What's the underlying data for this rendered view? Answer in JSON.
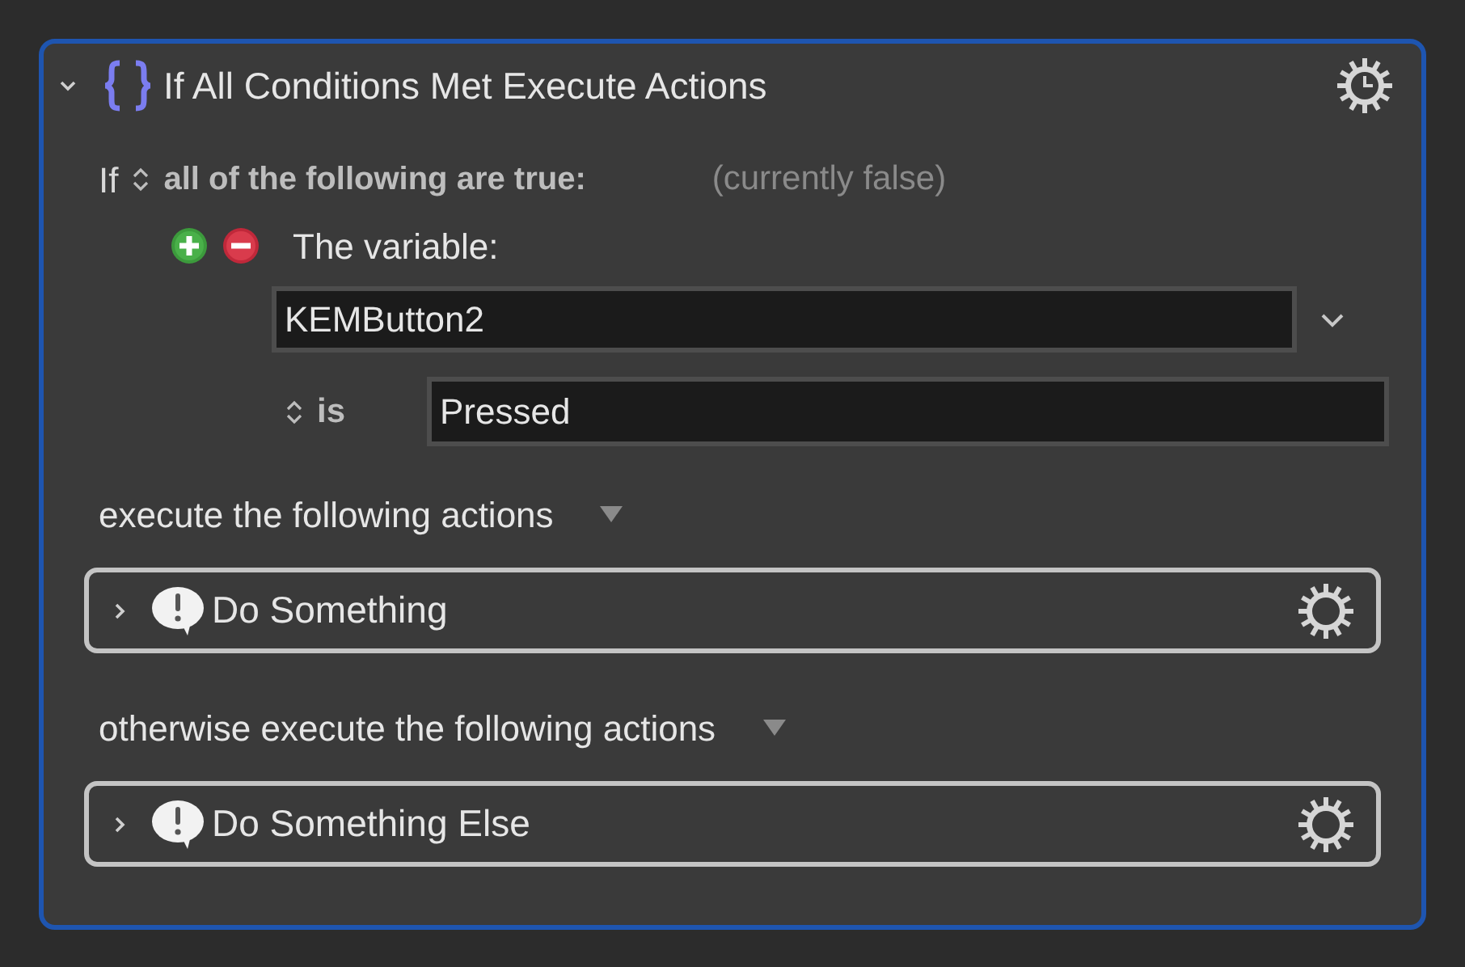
{
  "action": {
    "title": "If All Conditions Met Execute Actions",
    "expanded": true
  },
  "condition": {
    "prefix": "If",
    "mode": "all of the following are true:",
    "status": "(currently false)",
    "items": [
      {
        "label": "The variable:",
        "variable": "KEMButton2",
        "operator": "is",
        "value": "Pressed"
      }
    ]
  },
  "sections": [
    {
      "label": "execute the following actions",
      "actions": [
        {
          "title": "Do Something",
          "expanded": false
        }
      ]
    },
    {
      "label": "otherwise execute the following actions",
      "actions": [
        {
          "title": "Do Something Else",
          "expanded": false
        }
      ]
    }
  ]
}
